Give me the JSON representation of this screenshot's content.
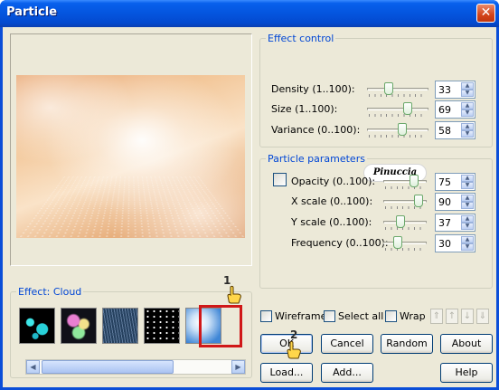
{
  "window": {
    "title": "Particle"
  },
  "preview": {
    "icon": "preview-image"
  },
  "effect": {
    "group_label": "Effect: Cloud",
    "thumbnails": [
      {
        "name": "bubbles",
        "selected": false
      },
      {
        "name": "bokeh",
        "selected": false
      },
      {
        "name": "rain",
        "selected": false
      },
      {
        "name": "stars",
        "selected": false
      },
      {
        "name": "cloud",
        "selected": true
      }
    ]
  },
  "effect_control": {
    "label": "Effect control",
    "rows": [
      {
        "label": "Density (1..100):",
        "value": "33",
        "level": 0.33
      },
      {
        "label": "Size (1..100):",
        "value": "69",
        "level": 0.69
      },
      {
        "label": "Variance (0..100):",
        "value": "58",
        "level": 0.58
      }
    ]
  },
  "particle_parameters": {
    "label": "Particle parameters",
    "rows": [
      {
        "label": "Opacity (0..100):",
        "value": "75",
        "level": 0.75
      },
      {
        "label": "X scale (0..100):",
        "value": "90",
        "level": 0.9
      },
      {
        "label": "Y scale (0..100):",
        "value": "37",
        "level": 0.37
      },
      {
        "label": "Frequency (0..100):",
        "value": "30",
        "level": 0.3
      }
    ]
  },
  "options": {
    "wireframe": "Wireframe",
    "select_all": "Select all",
    "wrap": "Wrap"
  },
  "buttons": {
    "ok": "OK",
    "cancel": "Cancel",
    "random": "Random",
    "about": "About",
    "load": "Load...",
    "add": "Add...",
    "help": "Help"
  },
  "watermark": "Pinuccia",
  "markers": {
    "one": "1",
    "two": "2"
  },
  "colors": {
    "accent": "#0046d5",
    "titlebar": "#0455de",
    "selection": "#d01818"
  }
}
